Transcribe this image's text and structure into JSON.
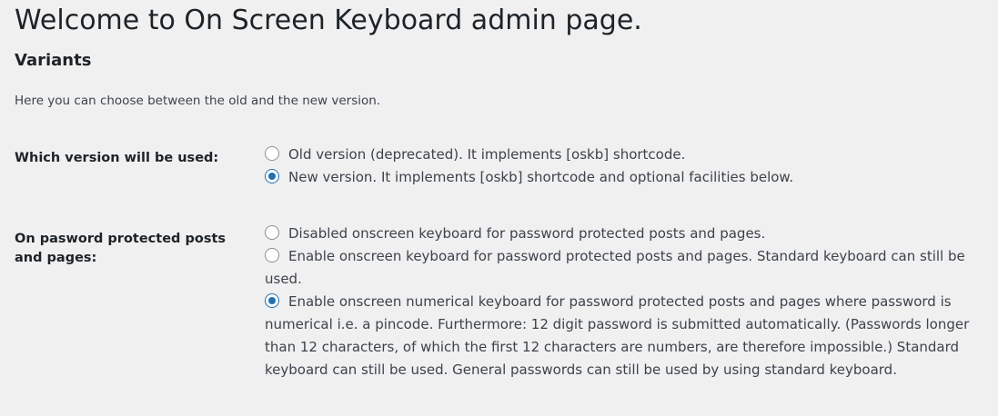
{
  "page": {
    "title": "Welcome to On Screen Keyboard admin page.",
    "section_title": "Variants",
    "description": "Here you can choose between the old and the new version."
  },
  "version_setting": {
    "label": "Which version will be used:",
    "options": [
      {
        "label": "Old version (deprecated). It implements [oskb] shortcode.",
        "checked": false
      },
      {
        "label": "New version. It implements [oskb] shortcode and optional facilities below.",
        "checked": true
      }
    ]
  },
  "password_setting": {
    "label_line1": "On pasword protected posts",
    "label_line2": "and pages:",
    "options": [
      {
        "label": "Disabled onscreen keyboard for password protected posts and pages.",
        "checked": false
      },
      {
        "label": "Enable onscreen keyboard for password protected posts and pages. Standard keyboard can still be used.",
        "checked": false
      },
      {
        "label": "Enable onscreen numerical keyboard for password protected posts and pages where password is numerical i.e. a pincode. Furthermore: 12 digit password is submitted automatically. (Passwords longer than 12 characters, of which the first 12 characters are numbers, are therefore impossible.) Standard keyboard can still be used. General passwords can still be used by using standard keyboard.",
        "checked": true
      }
    ]
  },
  "colors": {
    "background": "#f0f0f1",
    "accent": "#2271b1",
    "text": "#1d2327"
  }
}
